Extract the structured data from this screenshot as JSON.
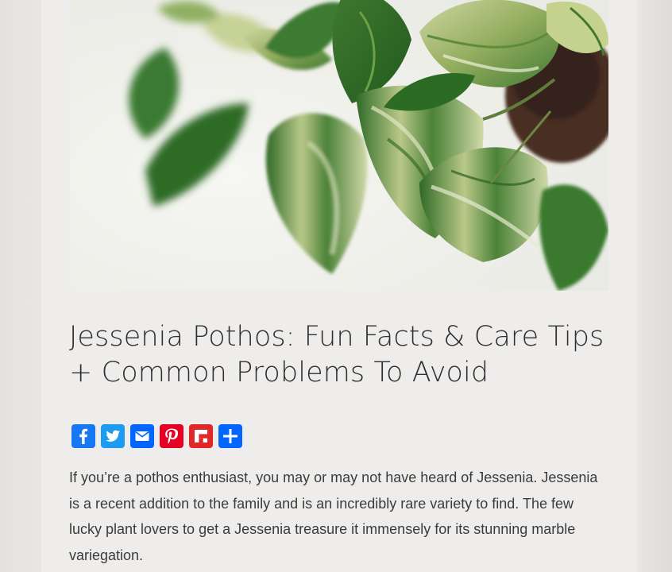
{
  "article": {
    "hero_image": {
      "subject": "Variegated Jessenia pothos leaves in a pot"
    },
    "title": "Jessenia Pothos: Fun Facts & Care Tips + Common Problems To Avoid",
    "share_buttons": [
      {
        "icon": "facebook-icon",
        "color": "#1877f2"
      },
      {
        "icon": "twitter-icon",
        "color": "#1d9bf0"
      },
      {
        "icon": "email-icon",
        "color": "#0166ff"
      },
      {
        "icon": "pinterest-icon",
        "color": "#e60023"
      },
      {
        "icon": "flipboard-icon",
        "color": "#e12828"
      },
      {
        "icon": "share-plus-icon",
        "color": "#0166ff"
      }
    ],
    "intro_text": "If you’re a pothos enthusiast, you may or may not have heard of Jessenia. Jessenia is a recent addition to the family and is an incredibly rare variety to find. The few lucky plant lovers to get a Jessenia treasure it immensely for its stunning marble variegation."
  },
  "colors": {
    "page_background": "#e7e5e2",
    "card_background": "#eeedec",
    "text": "#3b3b3b",
    "title_text": "#2f2f2f"
  }
}
